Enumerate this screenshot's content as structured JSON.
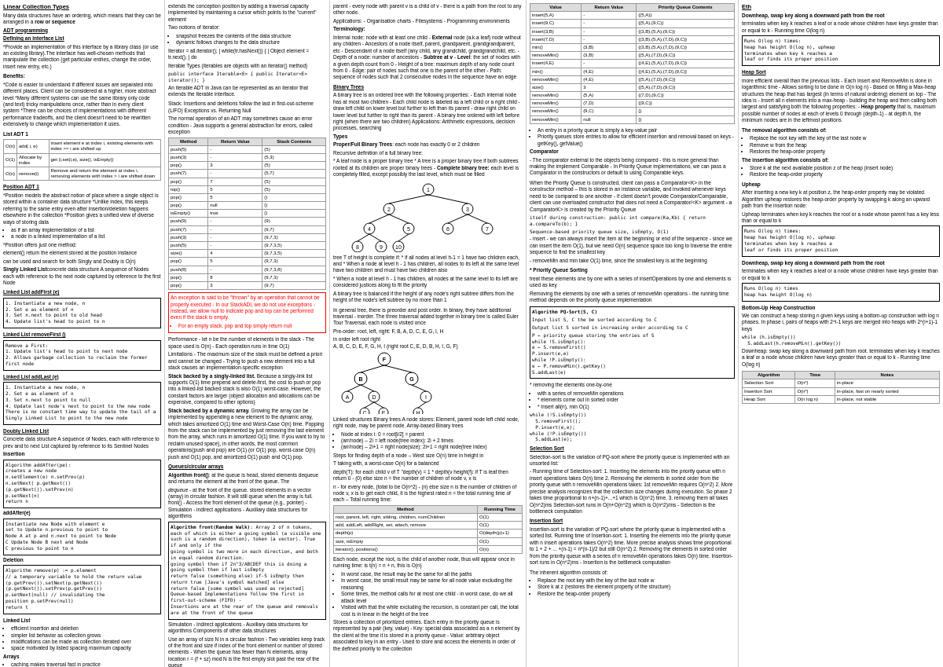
{
  "columns": {
    "col1": {
      "title": "Linear Collection Types",
      "sections": [
        {
          "heading": "Many data structures have an ordering, which means that they can be arranged in a row or sequence",
          "subheading": "ADT programming",
          "subheading2": "Defining an interface List"
        }
      ]
    }
  }
}
